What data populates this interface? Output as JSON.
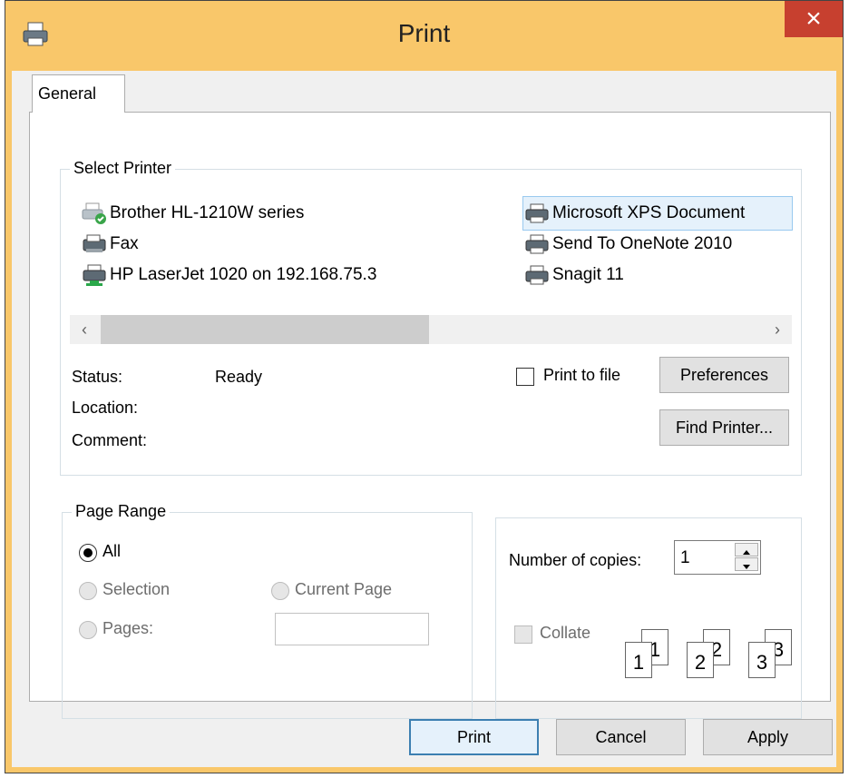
{
  "window": {
    "title": "Print",
    "close_glyph": "×",
    "accent": "#f9c76a",
    "close_color": "#c7402f"
  },
  "tabs": [
    {
      "label": "General",
      "active": true
    }
  ],
  "select_printer": {
    "group_title": "Select Printer",
    "printers": [
      {
        "name": "Brother HL-1210W series",
        "icon": "printer-default-icon",
        "selected": false
      },
      {
        "name": "Fax",
        "icon": "fax-icon",
        "selected": false
      },
      {
        "name": "HP LaserJet 1020 on 192.168.75.3",
        "icon": "network-printer-icon",
        "selected": false
      },
      {
        "name": "Microsoft XPS Document",
        "icon": "printer-icon",
        "selected": true
      },
      {
        "name": "Send To OneNote 2010",
        "icon": "printer-icon",
        "selected": false
      },
      {
        "name": "Snagit 11",
        "icon": "printer-icon",
        "selected": false
      }
    ],
    "scroll_left": "‹",
    "scroll_right": "›",
    "status_label": "Status:",
    "status_value": "Ready",
    "location_label": "Location:",
    "location_value": "",
    "comment_label": "Comment:",
    "comment_value": "",
    "print_to_file_label": "Print to file",
    "print_to_file_checked": false,
    "preferences_label": "Preferences",
    "find_printer_label": "Find Printer..."
  },
  "page_range": {
    "group_title": "Page Range",
    "all_label": "All",
    "all_selected": true,
    "selection_label": "Selection",
    "current_page_label": "Current Page",
    "pages_label": "Pages:",
    "pages_value": ""
  },
  "copies": {
    "number_label": "Number of copies:",
    "number_value": "1",
    "collate_label": "Collate",
    "collate_checked": false,
    "collate_icon_pages": [
      "1",
      "2",
      "3"
    ]
  },
  "footer": {
    "print_label": "Print",
    "cancel_label": "Cancel",
    "apply_label": "Apply"
  }
}
